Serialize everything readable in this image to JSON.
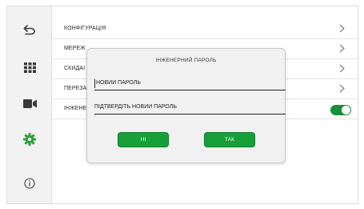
{
  "colors": {
    "accent_green": "#17a03a",
    "sidebar_bg": "#f2f2f2",
    "dialog_bg": "#f1f1f1"
  },
  "sidebar": {
    "items": [
      {
        "icon": "back-icon",
        "active": false
      },
      {
        "icon": "grid-icon",
        "active": false
      },
      {
        "icon": "camera-icon",
        "active": false
      },
      {
        "icon": "gear-icon",
        "active": true
      },
      {
        "icon": "info-icon",
        "active": false
      }
    ]
  },
  "settings": {
    "rows": [
      {
        "label": "КОНФІГУРАЦІЯ",
        "control": "chevron"
      },
      {
        "label": "МЕРЕЖ",
        "control": "chevron"
      },
      {
        "label": "СКИДАІ",
        "control": "chevron"
      },
      {
        "label": "ПЕРЕЗА",
        "control": "chevron"
      },
      {
        "label": "ІНЖЕНЕІ",
        "control": "toggle",
        "toggle_on": true
      }
    ]
  },
  "dialog": {
    "title": "ІНЖЕНЕРНИЙ ПАРОЛЬ",
    "new_password_placeholder": "НОВИЙ ПАРОЛЬ",
    "confirm_password_placeholder": "ПІДТВЕРДІТЬ НОВИЙ ПАРОЛЬ",
    "cancel_label": "НІ",
    "ok_label": "ТАК"
  }
}
